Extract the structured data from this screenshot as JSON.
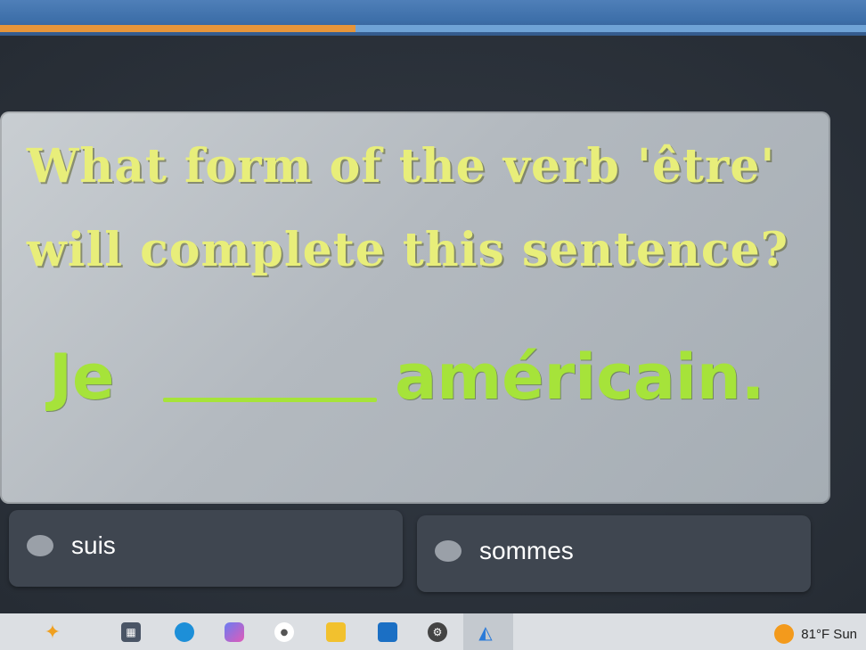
{
  "quiz": {
    "progress_percent": 41,
    "question_line1": "What form of the verb 'être'",
    "question_line2": "will complete this sentence?",
    "sentence_before": "Je",
    "sentence_after": "américain.",
    "answers": [
      {
        "label": "suis"
      },
      {
        "label": "sommes"
      }
    ]
  },
  "taskbar": {
    "icons": [
      "sparkle-icon",
      "calculator-icon",
      "edge-browser-icon",
      "copilot-icon",
      "app-icon",
      "folder-icon",
      "mail-icon",
      "settings-icon",
      "app-icon-highlighted"
    ],
    "weather": "81°F Sun"
  },
  "colors": {
    "question_text": "#e8ee7a",
    "sentence_text": "#a6e33a",
    "progress_fill": "#e6953a",
    "answer_bg": "#3f4650"
  }
}
